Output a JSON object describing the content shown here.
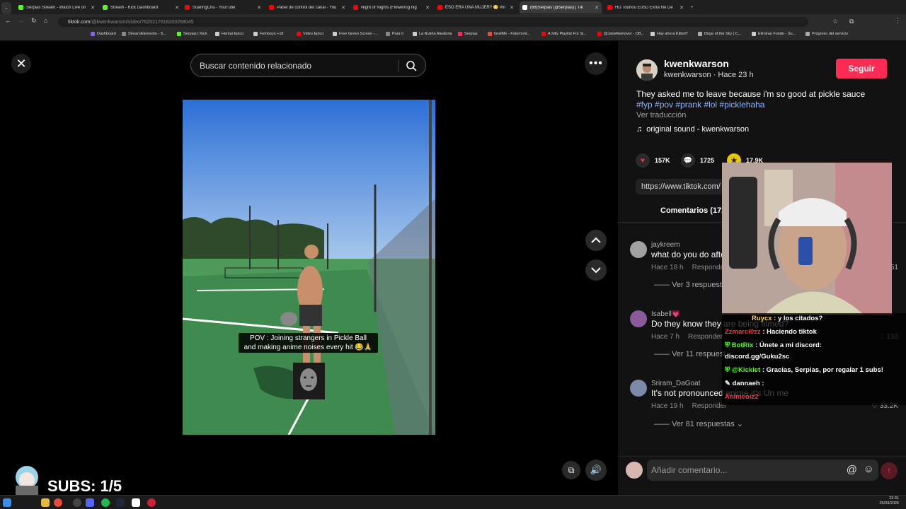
{
  "browser": {
    "tabs": [
      {
        "title": "Serpias Stream - Watch Live on",
        "color": "#53fc18"
      },
      {
        "title": "Stream - Kick Dashboard",
        "color": "#53fc18"
      },
      {
        "title": "SoaringChu - YouTube",
        "color": "#ff0000"
      },
      {
        "title": "Panel de control del canal - You",
        "color": "#ff0000"
      },
      {
        "title": "Night of Nights (Flowering nig",
        "color": "#ff0000"
      },
      {
        "title": "ESO ERA UNA MUJER? 😳 #m",
        "color": "#ff0000"
      },
      {
        "title": "(68)Serpias (@serpias) | Tik",
        "color": "#ffffff"
      },
      {
        "title": "HD Touhou EoSD Extra No De",
        "color": "#ff0000"
      }
    ],
    "new_tab_symbol": "+",
    "url_host": "tiktok.com",
    "url_path": "/@kwenkwarson/video/7620217618200268045",
    "bookmarks": [
      "Dashboard",
      "StreamElements - S...",
      "Serpias | Kick",
      "Hentai Epico",
      "Femboys +18",
      "Video Epico",
      "Free Green Screen -...",
      "Para ti",
      "La Ruleta Aleatoria",
      "Serpias",
      "GrafMe - Fotomont...",
      "A Silly Playlist For Si...",
      "@JaneRemover - OB...",
      "Hay ahora Kitbol?",
      "Dirge of the Sky | C...",
      "Eliminar Fondo - Su...",
      "Progreso del servicio"
    ]
  },
  "player": {
    "search_placeholder": "Buscar contenido relacionado",
    "caption_line1": "POV : Joining strangers in Pickle Ball",
    "caption_line2": "and making anime noises every hit 😂🙏"
  },
  "post": {
    "username": "kwenkwarson",
    "handle_time": "kwenkwarson · Hace 23 h",
    "follow_label": "Seguir",
    "description": "They asked me to leave because i'm so good at pickle sauce",
    "hashtags": "#fyp #pov #prank #lol #picklehaha",
    "translate": "Ver traducción",
    "sound": "original sound - kwenkwarson",
    "likes": "157K",
    "comments": "1725",
    "saves": "17.9K",
    "link": "https://www.tiktok.com/",
    "comments_tab": "Comentarios (172"
  },
  "comments": [
    {
      "user": "jaykreem",
      "text": "what do you do afte",
      "time": "Hace 18 h",
      "reply": "Responder",
      "likes": "51",
      "replies": "Ver 3 respuesta",
      "avatar": "#a0a0a0"
    },
    {
      "user": "Isabell💗",
      "text": "Do they know they are being filmed?",
      "time": "Hace 7 h",
      "reply": "Responder",
      "likes": "192",
      "replies": "Ver 11 respuest",
      "avatar": "#8a5a9a"
    },
    {
      "user": "Sriram_DaGoat",
      "text": "It's not pronounced anime it's Un me",
      "time": "Hace 19 h",
      "reply": "Responder",
      "likes": "33.2K",
      "replies": "Ver 81 respuestas",
      "avatar": "#7a8aa8"
    }
  ],
  "composer": {
    "placeholder": "Añadir comentario..."
  },
  "chat": [
    {
      "user": "Ruycx",
      "msg": ": y los citados?",
      "color": "#ffd24a"
    },
    {
      "user": "Zzmarci0zz",
      "msg": ": Haciendo tiktok",
      "color": "#ff3344"
    },
    {
      "user": "BotRix",
      "msg": ": Únete a mi discord:",
      "color": "#53fc18"
    },
    {
      "user": "",
      "msg": "discord.gg/Guku2sc",
      "color": "#ffffff"
    },
    {
      "user": "@Kicklet",
      "msg": ": Gracias, Serpias, por regalar 1 subs!",
      "color": "#53fc18"
    },
    {
      "user": "dannaeh",
      "msg": ":",
      "color": "#ffffff"
    },
    {
      "user": "Animeoiz2",
      "msg": "",
      "color": "#ff3344"
    }
  ],
  "stream": {
    "subs": "SUBS: 1/5"
  },
  "system": {
    "time": "23:31",
    "date": "25/03/2026"
  }
}
